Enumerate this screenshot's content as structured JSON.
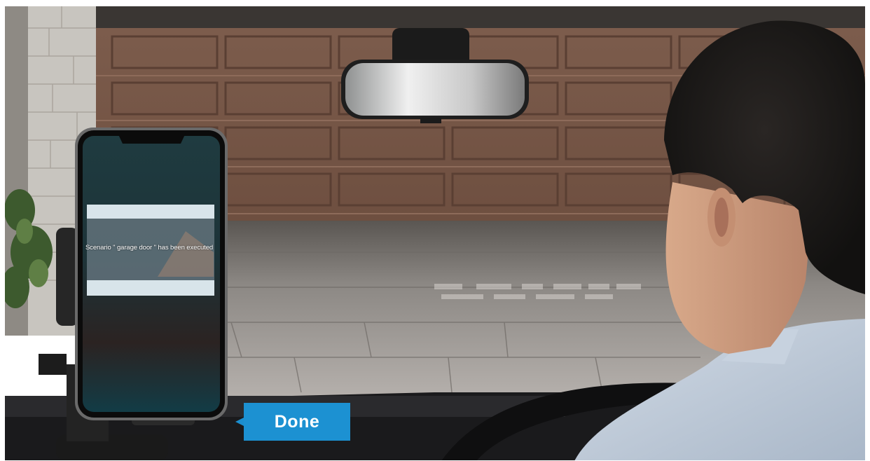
{
  "phone": {
    "notification": "Scenario \" garage door \" has been executed"
  },
  "callout": {
    "label": "Done",
    "color": "#1a8fd0"
  },
  "colors": {
    "garage_door": "#7a5a4a",
    "driveway": "#a8a4a2",
    "brick_pillar": "#c9c6c0",
    "shirt": "#b9c6d6"
  }
}
